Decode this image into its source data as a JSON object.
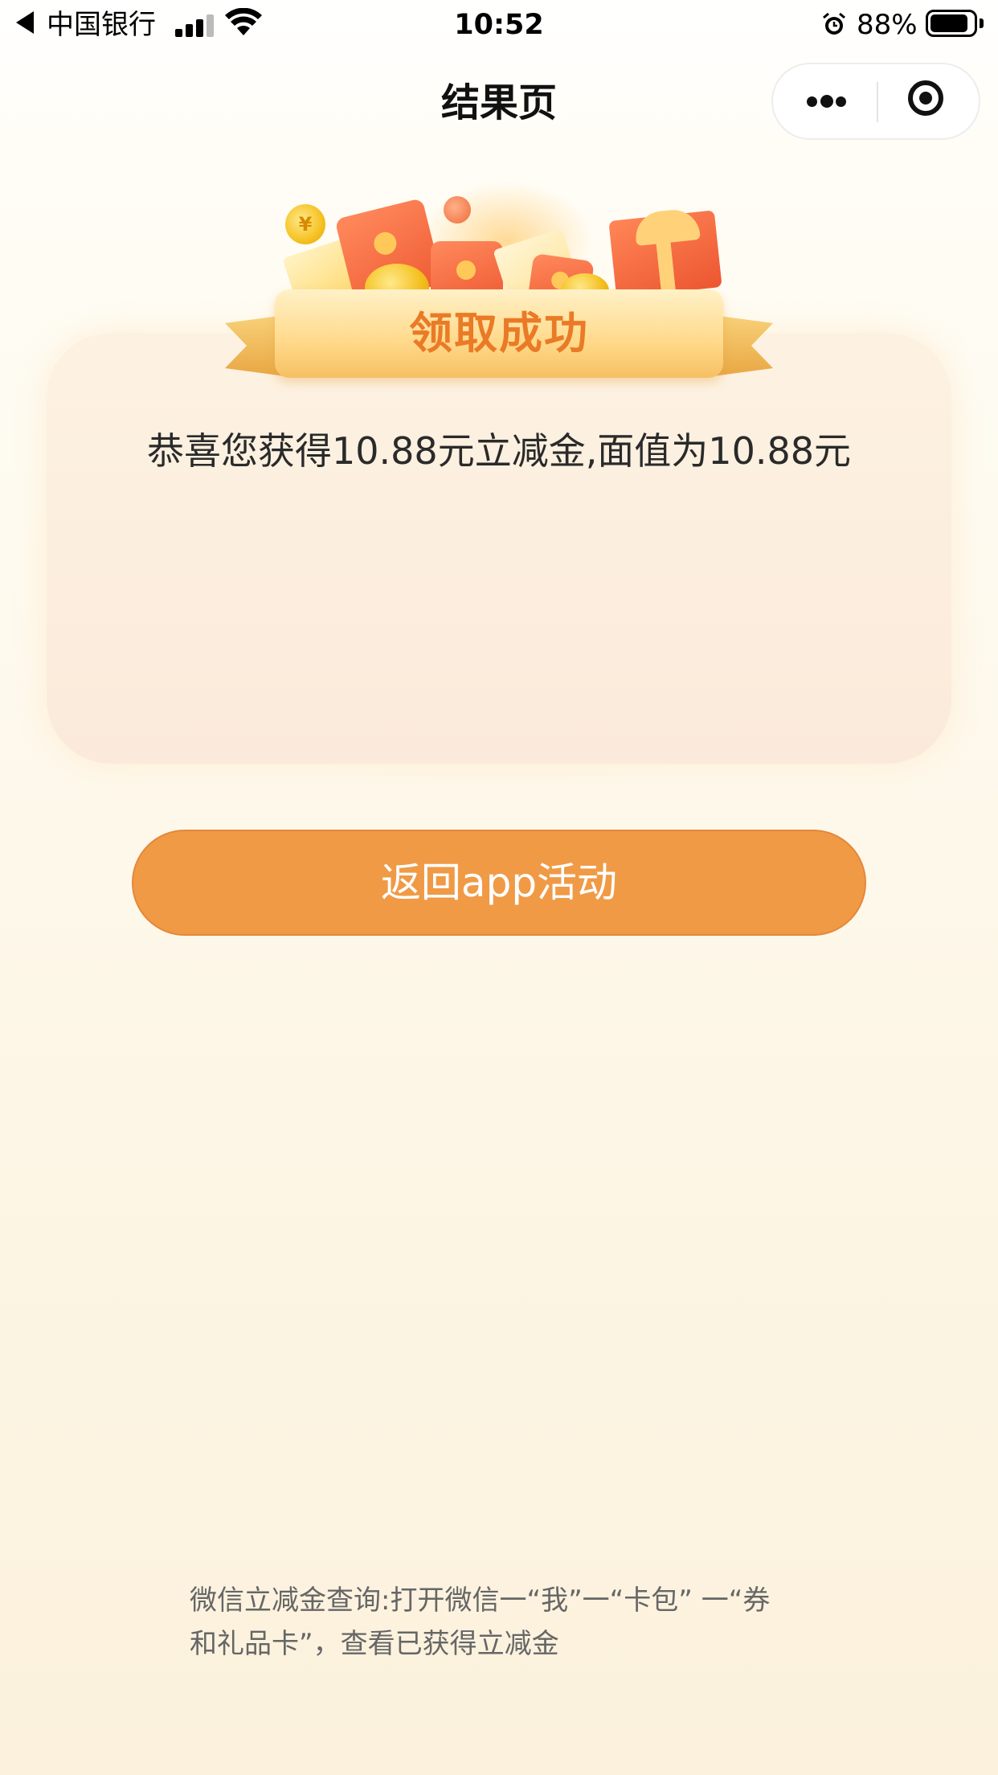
{
  "status_bar": {
    "carrier": "中国银行",
    "time": "10:52",
    "battery_percent": "88%",
    "battery_level": 0.88,
    "icons": [
      "back-arrow-icon",
      "signal-icon",
      "wifi-icon",
      "alarm-icon",
      "battery-icon"
    ]
  },
  "nav": {
    "title": "结果页",
    "capsule_icons": [
      "more-dots-icon",
      "close-target-icon"
    ]
  },
  "banner": {
    "title": "领取成功",
    "coin_symbol": "¥"
  },
  "card": {
    "message": "恭喜您获得10.88元立减金,面值为10.88元"
  },
  "button": {
    "label": "返回app活动"
  },
  "footer": {
    "line1": "微信立减金查询:打开微信一“我”一“卡包” 一“券",
    "line2": "和礼品卡”，查看已获得立减金"
  },
  "colors": {
    "button": "#f09a46",
    "banner_text": "#ea7a26",
    "card_bg": "#fbeadb",
    "page_bg": "#fdf6e6"
  }
}
